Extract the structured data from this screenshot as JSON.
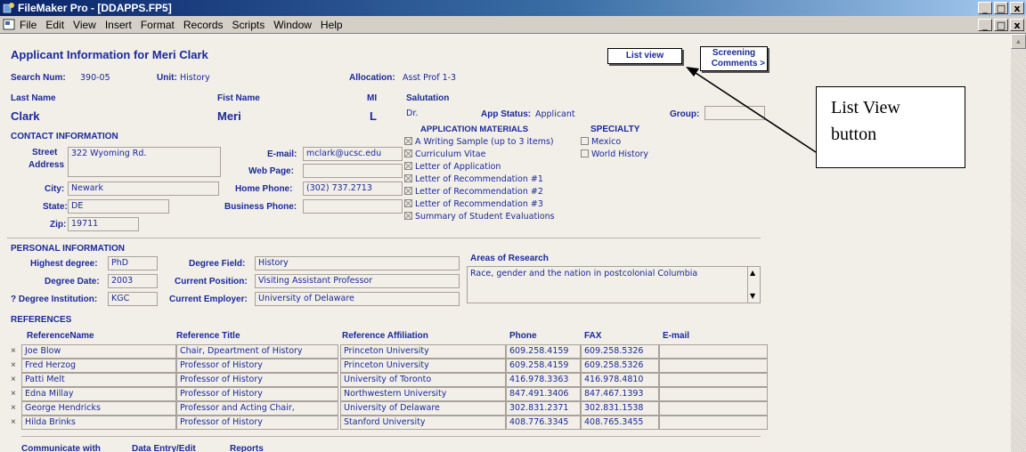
{
  "window": {
    "title": "FileMaker Pro - [DDAPPS.FP5]",
    "buttons": [
      "_",
      "□",
      "x"
    ]
  },
  "menubar": {
    "items": [
      "File",
      "Edit",
      "View",
      "Insert",
      "Format",
      "Records",
      "Scripts",
      "Window",
      "Help"
    ]
  },
  "form": {
    "heading": "Applicant Information for Meri Clark",
    "list_view_btn": "List view",
    "screening_btn_line1": "Screening",
    "screening_btn_line2": "Comments >",
    "search_num_label": "Search Num:",
    "search_num_value": "390-05",
    "unit_label": "Unit:",
    "unit_value": "History",
    "allocation_label": "Allocation:",
    "allocation_value": "Asst Prof 1-3",
    "last_name_label": "Last Name",
    "first_name_label": "Fist Name",
    "mi_label": "MI",
    "salutation_label": "Salutation",
    "last_name": "Clark",
    "first_name": "Meri",
    "mi": "L",
    "salutation": "Dr.",
    "app_status_label": "App Status:",
    "app_status_value": "Applicant",
    "group_label": "Group:",
    "group_value": "",
    "contact_heading": "CONTACT INFORMATION",
    "street_label": "Street",
    "address_label": "Address",
    "street_value": "322 Wyoming Rd.",
    "city_label": "City:",
    "city_value": "Newark",
    "state_label": "State:",
    "state_value": "DE",
    "zip_label": "Zip:",
    "zip_value": "19711",
    "email_label": "E-mail:",
    "email_value": "mclark@ucsc.edu",
    "webpage_label": "Web Page:",
    "webpage_value": "",
    "home_phone_label": "Home Phone:",
    "home_phone_value": "(302) 737.2713",
    "business_phone_label": "Business Phone:",
    "business_phone_value": "",
    "materials_heading": "APPLICATION MATERIALS",
    "materials": [
      "A Writing Sample (up to 3 items)",
      "Curriculum Vitae",
      "Letter of Application",
      "Letter of Recommendation #1",
      "Letter of Recommendation #2",
      "Letter of Recommendation #3",
      "Summary of Student Evaluations"
    ],
    "specialty_heading": "SPECIALTY",
    "specialties": [
      "Mexico",
      "World History"
    ],
    "personal_heading": "PERSONAL INFORMATION",
    "highest_degree_label": "Highest degree:",
    "highest_degree_value": "PhD",
    "degree_date_label": "Degree Date:",
    "degree_date_value": "2003",
    "degree_inst_label": "? Degree Institution:",
    "degree_inst_value": "KGC",
    "degree_field_label": "Degree Field:",
    "degree_field_value": "History",
    "current_position_label": "Current Position:",
    "current_position_value": "Visiting Assistant Professor",
    "current_employer_label": "Current Employer:",
    "current_employer_value": "University of Delaware",
    "research_label": "Areas of Research",
    "research_value": "Race, gender and the nation in postcolonial Columbia",
    "references_heading": "REFERENCES",
    "ref_headers": [
      "ReferenceName",
      "Reference Title",
      "Reference Affiliation",
      "Phone",
      "FAX",
      "E-mail"
    ],
    "references": [
      {
        "name": "Joe Blow",
        "title": "Chair, Dpeartment of History",
        "affiliation": "Princeton University",
        "phone": "609.258.4159",
        "fax": "609.258.5326",
        "email": ""
      },
      {
        "name": "Fred Herzog",
        "title": "Professor of History",
        "affiliation": "Princeton University",
        "phone": "609.258.4159",
        "fax": "609.258.5326",
        "email": ""
      },
      {
        "name": "Patti Melt",
        "title": "Professor of History",
        "affiliation": "University of Toronto",
        "phone": "416.978.3363",
        "fax": "416.978.4810",
        "email": ""
      },
      {
        "name": "Edna Millay",
        "title": "Professor of History",
        "affiliation": "Northwestern University",
        "phone": "847.491.3406",
        "fax": "847.467.1393",
        "email": ""
      },
      {
        "name": "George Hendricks",
        "title": "Professor and Acting Chair,",
        "affiliation": "University of Delaware",
        "phone": "302.831.2371",
        "fax": "302.831.1538",
        "email": ""
      },
      {
        "name": "Hilda Brinks",
        "title": "Professor of History",
        "affiliation": "Stanford University",
        "phone": "408.776.3345",
        "fax": "408.765.3455",
        "email": ""
      }
    ],
    "footer_tabs": [
      "Communicate with",
      "Data Entry/Edit",
      "Reports"
    ]
  },
  "annotation": {
    "line1": "List View",
    "line2": "button"
  }
}
